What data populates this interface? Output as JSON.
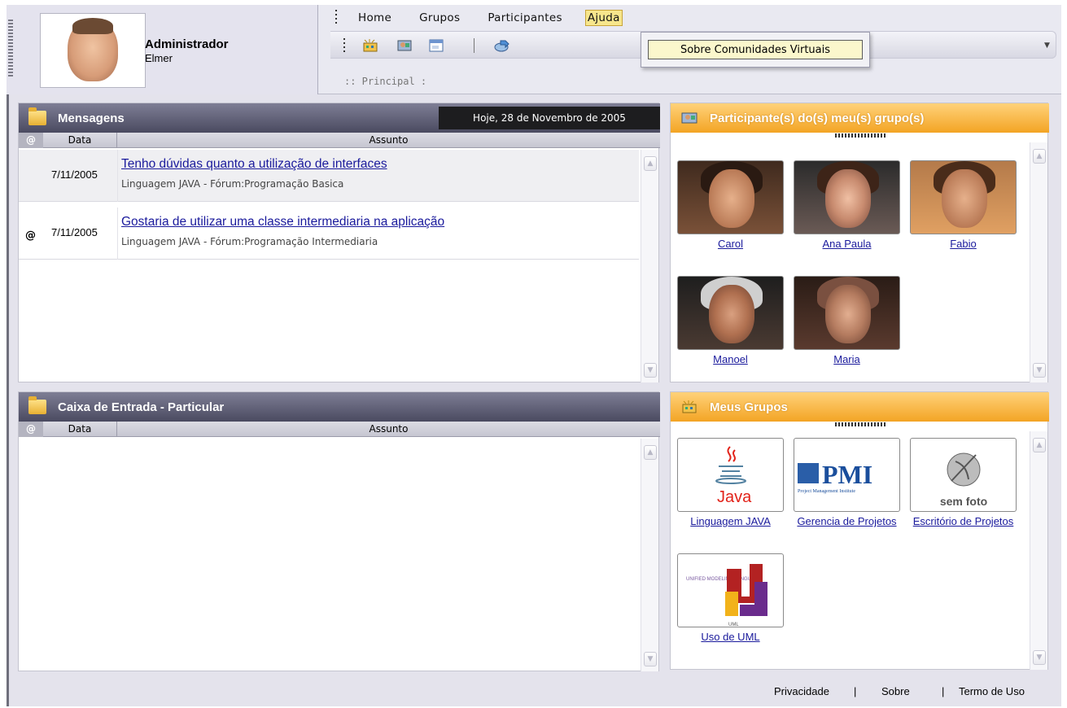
{
  "user": {
    "role": "Administrador",
    "name": "Elmer"
  },
  "menu": {
    "items": [
      "Home",
      "Grupos",
      "Participantes",
      "Ajuda"
    ],
    "active": "Ajuda"
  },
  "dropdown": {
    "item": "Sobre Comunidades Virtuais"
  },
  "breadcrumb": ":: Principal :",
  "mensagens": {
    "title": "Mensagens",
    "date": "Hoje, 28 de Novembro de 2005",
    "col_data": "Data",
    "col_assunto": "Assunto",
    "rows": [
      {
        "date": "7/11/2005",
        "subject": "Tenho dúvidas quanto a utilização de interfaces",
        "sub": "Linguagem JAVA - Fórum:Programação Basica",
        "attach": false
      },
      {
        "date": "7/11/2005",
        "subject": "Gostaria de utilizar uma classe intermediaria na aplicação",
        "sub": "Linguagem JAVA - Fórum:Programação Intermediaria",
        "attach": true
      }
    ]
  },
  "caixa": {
    "title": "Caixa de Entrada - Particular",
    "col_data": "Data",
    "col_assunto": "Assunto"
  },
  "participantes": {
    "title": "Participante(s) do(s) meu(s) grupo(s)",
    "people": [
      {
        "name": "Carol"
      },
      {
        "name": "Ana Paula"
      },
      {
        "name": "Fabio"
      },
      {
        "name": "Manoel"
      },
      {
        "name": "Maria"
      }
    ]
  },
  "grupos": {
    "title": "Meus Grupos",
    "items": [
      {
        "name": "Linguagem JAVA",
        "logo_text": "Java"
      },
      {
        "name": "Gerencia de Projetos",
        "logo_text": "PMI",
        "logo_sub": "Project Management Institute"
      },
      {
        "name": "Escritório de Projetos",
        "logo_text": "sem foto"
      },
      {
        "name": "Uso de UML",
        "logo_text": "UML",
        "logo_sub": "UNIFIED MODELING LANGUAGE"
      }
    ]
  },
  "footer": {
    "links": [
      "Privacidade",
      "Sobre",
      "Termo de Uso"
    ],
    "separator": "|"
  },
  "colors": {
    "header_dark": "#4a4a60",
    "header_orange": "#f3a424",
    "link": "#1a1a9c",
    "menu_active": "#f7e68c"
  }
}
